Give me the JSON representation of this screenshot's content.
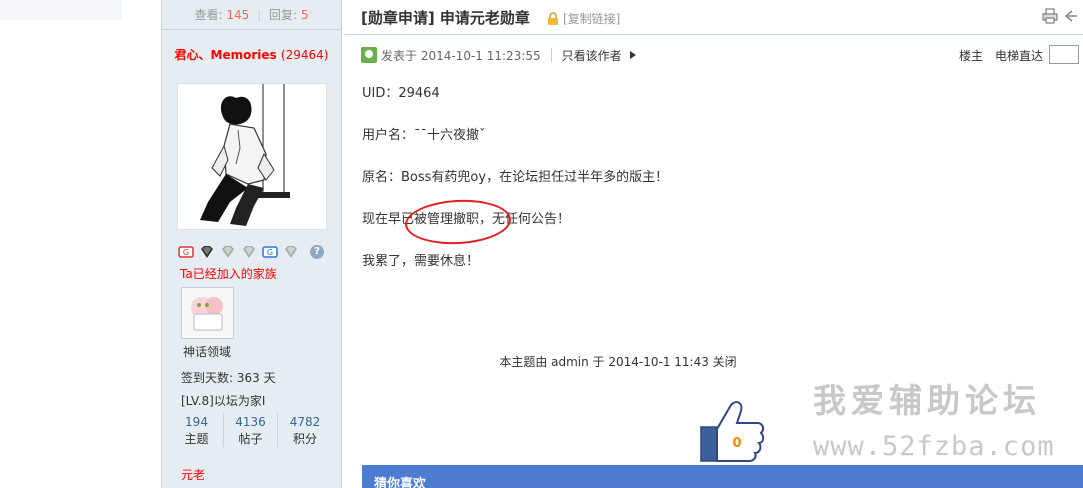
{
  "stats": {
    "views_label": "查看:",
    "views": "145",
    "replies_label": "回复:",
    "replies": "5"
  },
  "author": {
    "name": "君心、Memories",
    "uid_display": "(29464)",
    "family_line": "Ta已经加入的家族",
    "family_name": "神话领域",
    "signin": "签到天数: 363 天",
    "level": "[LV.8]以坛为家I",
    "counts": [
      {
        "value": "194",
        "label": "主题"
      },
      {
        "value": "4136",
        "label": "帖子"
      },
      {
        "value": "4782",
        "label": "积分"
      }
    ],
    "rank": "元老",
    "medal_icons": [
      "red-medal-icon",
      "black-diamond-icon",
      "gray-diamond-icon",
      "gray-diamond-icon",
      "blue-medal-icon",
      "gray-diamond-icon"
    ],
    "help_badge": "?"
  },
  "thread": {
    "title": "[勋章申请] 申请元老勋章",
    "copy_link": "[复制链接]"
  },
  "post": {
    "posted_at": "发表于 2014-10-1 11:23:55",
    "only_author": "只看该作者",
    "floor": "楼主",
    "elevator": "电梯直达",
    "content": [
      "UID：29464",
      "用户名：ˉˉ十六夜撤ˇ",
      "原名：Boss有药兜oy，在论坛担任过半年多的版主！",
      "现在早已被管理撤职，无任何公告！",
      "我累了，需要休息！"
    ],
    "closed_note": "本主题由 admin 于 2014-10-1 11:43 关闭",
    "like_count": "0"
  },
  "watermark": {
    "title": "我爱辅助论坛",
    "url": "www.52fzba.com"
  },
  "guess": {
    "title": "猜你喜欢"
  },
  "colors": {
    "accent_blue": "#4c7bd0",
    "sidebar_bg": "#e5edf2",
    "author_red": "#ff0000",
    "annotation_red": "#e02020"
  }
}
